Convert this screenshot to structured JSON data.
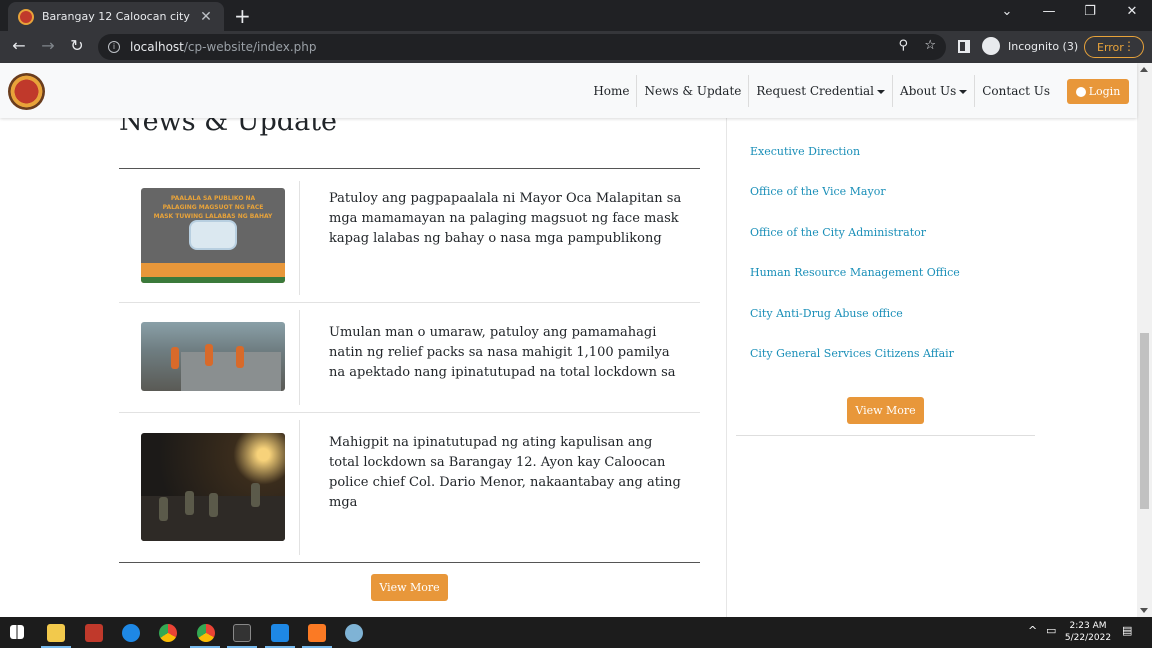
{
  "browser": {
    "tab_title": "Barangay 12 Caloocan city",
    "url_host": "localhost",
    "url_path": "/cp-website/index.php",
    "profile_label": "Incognito (3)",
    "error_label": "Error"
  },
  "site": {
    "nav": {
      "home": "Home",
      "news": "News & Update",
      "request": "Request Credential",
      "about": "About Us",
      "contact": "Contact Us",
      "login": "Login"
    },
    "news": {
      "title": "News & Update",
      "items": [
        {
          "text": "Patuloy ang pagpapaalala ni Mayor Oca Malapitan sa mga mamamayan na palaging magsuot ng face mask kapag lalabas ng bahay o nasa mga pampublikong",
          "image_text": "PAALALA SA PUBLIKO NA PALAGING MAGSUOT NG FACE MASK TUWING LALABAS NG BAHAY"
        },
        {
          "text": "Umulan man o umaraw, patuloy ang pamamahagi natin ng relief packs sa nasa mahigit 1,100 pamilya na apektado nang ipinatutupad na total lockdown sa"
        },
        {
          "text": "Mahigpit na ipinatutupad ng ating kapulisan ang total lockdown sa Barangay 12. Ayon kay Caloocan police chief Col. Dario Menor, nakaantabay ang ating mga"
        }
      ],
      "view_more": "View More"
    },
    "offices": {
      "items": [
        "Executive Direction",
        "Office of the Vice Mayor",
        "Office of the City Administrator",
        "Human Resource Management Office",
        "City Anti-Drug Abuse office",
        "City General Services Citizens Affair"
      ],
      "view_more": "View More"
    }
  },
  "taskbar": {
    "time": "2:23 AM",
    "date": "5/22/2022"
  },
  "colors": {
    "accent": "#e8973a",
    "link": "#1a8fb8"
  }
}
